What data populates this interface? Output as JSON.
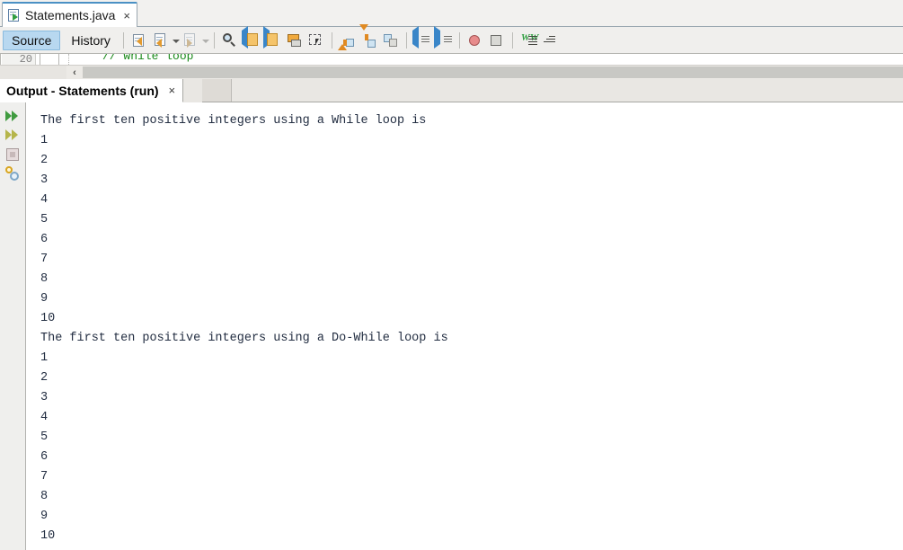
{
  "editor": {
    "file_tab": {
      "title": "Statements.java",
      "close": "×",
      "icon": "java-file-icon"
    },
    "view_tabs": [
      {
        "label": "Source",
        "active": true
      },
      {
        "label": "History",
        "active": false
      }
    ],
    "toolbar_icons": [
      "last-edit-icon",
      "back-navigate-icon",
      "back-navigate-dropdown-icon",
      "forward-navigate-icon",
      "forward-navigate-dropdown-icon",
      "find-selection-icon",
      "previous-bookmark-icon",
      "next-bookmark-icon",
      "toggle-bookmark-icon",
      "rectangular-selection-icon",
      "shift-line-up-icon",
      "shift-line-down-icon",
      "comment-icon",
      "shift-line-left-icon",
      "shift-line-right-icon",
      "toggle-breakpoint-icon",
      "stop-icon",
      "next-error-icon",
      "previous-error-icon"
    ],
    "code_sliver": {
      "line_number": "20",
      "comment_text": "// while loop"
    },
    "hscroll": {
      "left_arrow": "‹"
    }
  },
  "output": {
    "tab": {
      "title": "Output - Statements (run)",
      "close": "×"
    },
    "gutter_icons": [
      "rerun-icon",
      "rerun-with-arguments-icon",
      "stop-process-icon",
      "output-settings-icon"
    ],
    "lines": [
      "The first ten positive integers using a While loop is",
      "1",
      "2",
      "3",
      "4",
      "5",
      "6",
      "7",
      "8",
      "9",
      "10",
      "The first ten positive integers using a Do-While loop is",
      "1",
      "2",
      "3",
      "4",
      "5",
      "6",
      "7",
      "8",
      "9",
      "10"
    ]
  },
  "colors": {
    "accent_tab": "#4a90c4",
    "active_view_tab": "#b8d8f0",
    "comment_green": "#1a8a1a",
    "output_text": "#232e42",
    "chrome": "#f0efed"
  }
}
